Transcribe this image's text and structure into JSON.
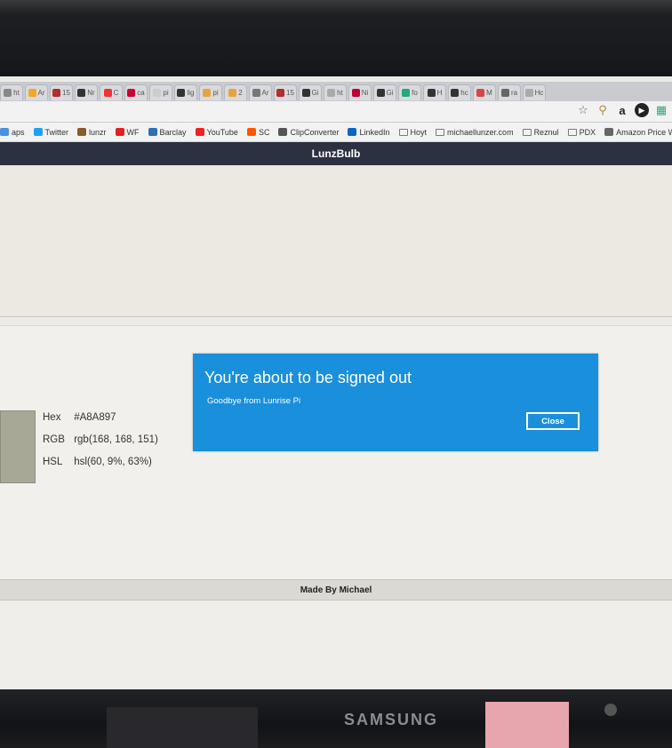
{
  "monitor": {
    "brand": "SAMSUNG"
  },
  "browser": {
    "tabs": [
      {
        "label": "ht",
        "color": "#888"
      },
      {
        "label": "Ar",
        "color": "#f5a623"
      },
      {
        "label": "15",
        "color": "#b32d2e"
      },
      {
        "label": "Nr",
        "color": "#333"
      },
      {
        "label": "C",
        "color": "#e33"
      },
      {
        "label": "ca",
        "color": "#c03"
      },
      {
        "label": "pi",
        "color": "#ccc"
      },
      {
        "label": "lig",
        "color": "#333"
      },
      {
        "label": "pi",
        "color": "#e8a33a"
      },
      {
        "label": "2",
        "color": "#e8a33a"
      },
      {
        "label": "Ar",
        "color": "#777"
      },
      {
        "label": "15",
        "color": "#b32d2e"
      },
      {
        "label": "Gi",
        "color": "#333"
      },
      {
        "label": "ht",
        "color": "#aaa"
      },
      {
        "label": "Ni",
        "color": "#b03"
      },
      {
        "label": "Gi",
        "color": "#333"
      },
      {
        "label": "fo",
        "color": "#2a7"
      },
      {
        "label": "H",
        "color": "#333"
      },
      {
        "label": "hc",
        "color": "#333"
      },
      {
        "label": "M",
        "color": "#d44"
      },
      {
        "label": "ra",
        "color": "#666"
      },
      {
        "label": "Hc",
        "color": "#aaa"
      }
    ],
    "bookmarks": [
      {
        "label": "aps",
        "color": "#4a90e2"
      },
      {
        "label": "Twitter",
        "color": "#1da1f2"
      },
      {
        "label": "lunzr",
        "color": "#8a5a2b"
      },
      {
        "label": "WF",
        "color": "#d22"
      },
      {
        "label": "Barclay",
        "color": "#2c6fb5"
      },
      {
        "label": "YouTube",
        "color": "#e22"
      },
      {
        "label": "SC",
        "color": "#f50"
      },
      {
        "label": "ClipConverter",
        "color": "#555"
      },
      {
        "label": "LinkedIn",
        "color": "#0a66c2"
      },
      {
        "label": "Hoyt",
        "color": "folder"
      },
      {
        "label": "michaellunzer.com",
        "color": "folder"
      },
      {
        "label": "Reznul",
        "color": "folder"
      },
      {
        "label": "PDX",
        "color": "folder"
      },
      {
        "label": "Amazon Price Wa",
        "color": "#666"
      }
    ]
  },
  "app": {
    "title": "LunzBulb",
    "color_info": {
      "hex_label": "Hex",
      "hex_value": "#A8A897",
      "rgb_label": "RGB",
      "rgb_value": "rgb(168, 168, 151)",
      "hsl_label": "HSL",
      "hsl_value": "hsl(60, 9%, 63%)",
      "swatch_color": "#A8A897"
    },
    "footer": "Made By Michael"
  },
  "modal": {
    "title": "You're about to be signed out",
    "message": "Goodbye from Lunrise Pi",
    "close_label": "Close",
    "bg_color": "#1a8fdc"
  }
}
